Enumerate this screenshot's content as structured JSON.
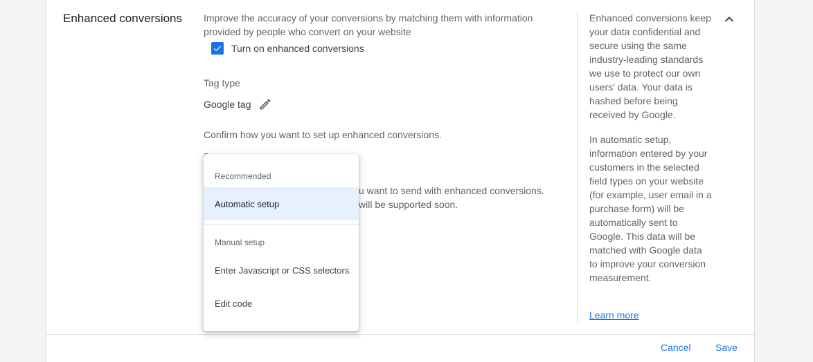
{
  "section": {
    "title": "Enhanced conversions",
    "description": "Improve the accuracy of your conversions by matching them with information provided by people who convert on your website",
    "checkbox_label": "Turn on enhanced conversions",
    "checkbox_checked": true,
    "tag_type_label": "Tag type",
    "tag_type_value": "Google tag",
    "confirm_text": "Confirm how you want to set up enhanced conversions.",
    "obscured_line_1": "u want to send with enhanced conversions.",
    "obscured_line_2": "will be supported soon."
  },
  "dropdown": {
    "group_recommended": "Recommended",
    "item_automatic": "Automatic setup",
    "group_manual": "Manual setup",
    "item_selectors": "Enter Javascript or CSS selectors",
    "item_edit_code": "Edit code",
    "selected": "Automatic setup"
  },
  "sidebar": {
    "paragraph_1": "Enhanced conversions keep your data confidential and secure using the same industry-leading standards we use to protect our own users' data. Your data is hashed before being received by Google.",
    "paragraph_2": "In automatic setup, information entered by your customers in the selected field types on your website (for example, user email in a purchase form) will be automatically sent to Google. This data will be matched with Google data to improve your conversion measurement.",
    "learn_more": "Learn more"
  },
  "footer": {
    "cancel_label": "Cancel",
    "save_label": "Save"
  },
  "colors": {
    "accent": "#1a73e8",
    "selected_bg": "#e8f0fe"
  },
  "icons": {
    "checkbox": "check-icon",
    "edit": "pencil-icon",
    "collapse": "chevron-up-icon"
  }
}
